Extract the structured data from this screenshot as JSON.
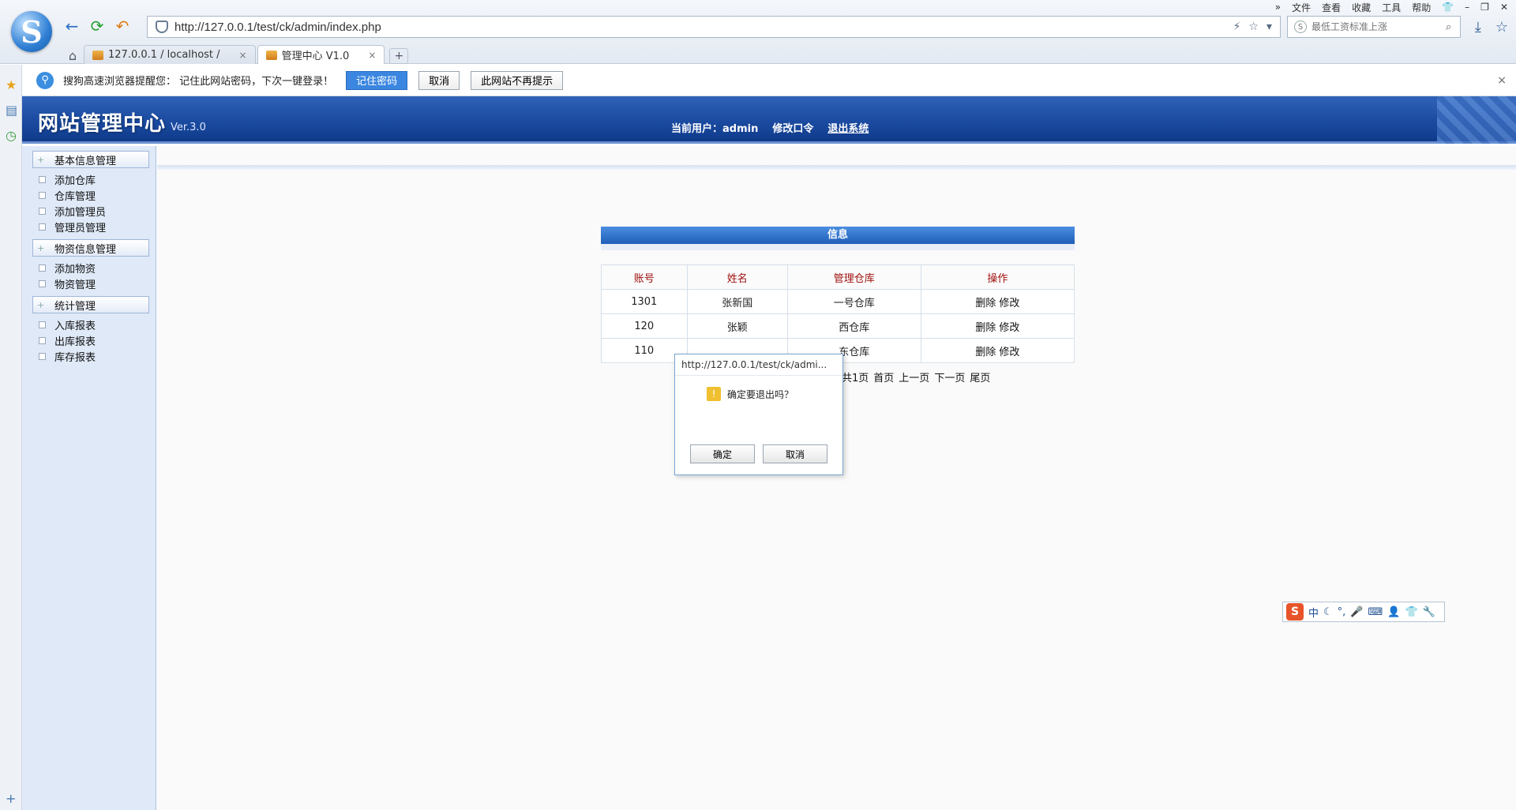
{
  "browser": {
    "url": "http://127.0.0.1/test/ck/admin/index.php",
    "search_placeholder": "最低工资标准上涨",
    "menu": [
      "»",
      "文件",
      "查看",
      "收藏",
      "工具",
      "帮助"
    ],
    "tabs": [
      {
        "label": "127.0.0.1 / localhost /",
        "close": "×"
      },
      {
        "label": "管理中心 V1.0",
        "close": "×"
      }
    ],
    "new_tab": "+"
  },
  "password_bar": {
    "message": "搜狗高速浏览器提醒您： 记住此网站密码，下次一键登录！",
    "remember": "记住密码",
    "cancel": "取消",
    "never": "此网站不再提示",
    "close": "×"
  },
  "header": {
    "brand": "网站管理中心",
    "version": "Ver.3.0",
    "current_user": "当前用户：admin",
    "change_password": "修改口令",
    "logout": "退出系统"
  },
  "sidebar": {
    "groups": [
      {
        "title": "基本信息管理",
        "items": [
          "添加仓库",
          "仓库管理",
          "添加管理员",
          "管理员管理"
        ]
      },
      {
        "title": "物资信息管理",
        "items": [
          "添加物资",
          "物资管理"
        ]
      },
      {
        "title": "统计管理",
        "items": [
          "入库报表",
          "出库报表",
          "库存报表"
        ]
      }
    ]
  },
  "panel": {
    "title": "信息",
    "columns": [
      "账号",
      "姓名",
      "管理仓库",
      "操作"
    ],
    "rows": [
      {
        "account": "1301",
        "name": "张新国",
        "warehouse": "一号仓库"
      },
      {
        "account": "120",
        "name": "张颖",
        "warehouse": "西仓库"
      },
      {
        "account": "110",
        "name": "",
        "warehouse": "东仓库"
      }
    ],
    "actions": {
      "delete": "删除",
      "edit": "修改"
    },
    "pager": [
      "共1页",
      "首页",
      "上一页",
      "下一页",
      "尾页"
    ]
  },
  "dialog": {
    "title": "http://127.0.0.1/test/ck/admi...",
    "question": "确定要退出吗？",
    "ok": "确定",
    "cancel": "取消"
  },
  "ime": {
    "mode": "中"
  }
}
